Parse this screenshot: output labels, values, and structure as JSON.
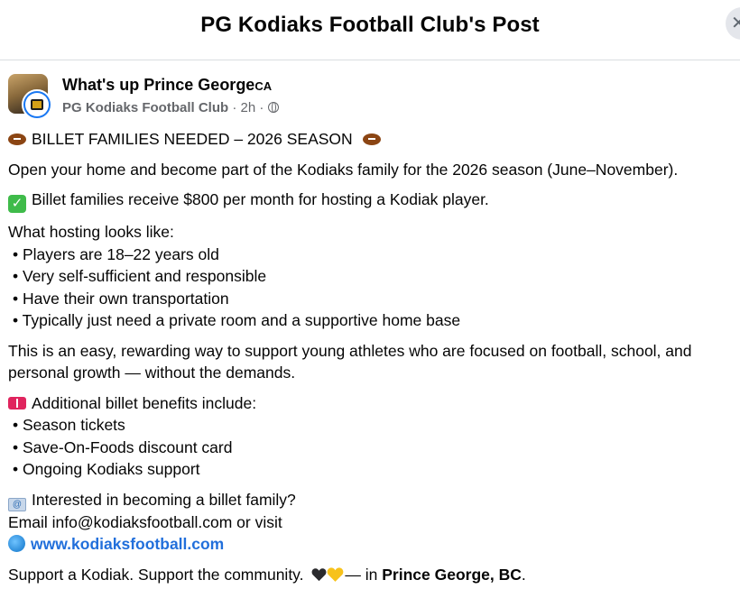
{
  "header": {
    "title": "PG Kodiaks Football Club's Post",
    "close_icon": "close-icon"
  },
  "author": {
    "group_name": "What's up Prince George",
    "group_suffix": "CA",
    "page_name": "PG Kodiaks Football Club",
    "separator": " · ",
    "time": "2h",
    "audience_icon": "globe-icon"
  },
  "post": {
    "headline": "BILLET FAMILIES NEEDED – 2026 SEASON",
    "intro": "Open your home and become part of the Kodiaks family for the 2026 season (June–November).",
    "payment": "Billet families receive $800 per month for hosting a Kodiak player.",
    "hosting_title": "What hosting looks like:",
    "hosting_items": [
      "• Players are 18–22 years old",
      "• Very self-sufficient and responsible",
      "• Have their own transportation",
      "• Typically just need a private room and a supportive home base"
    ],
    "rewarding_line1": "This is an easy, rewarding way to support young athletes who are focused on football, school, and",
    "rewarding_line2": "personal growth — without the demands.",
    "benefits_title": "Additional billet benefits include:",
    "benefit_items": [
      "• Season tickets",
      "• Save-On-Foods discount card",
      "• Ongoing Kodiaks support"
    ],
    "interested": "Interested in becoming a billet family?",
    "email_line": "Email info@kodiaksfootball.com or visit",
    "website": "www.kodiaksfootball.com",
    "closing": "Support a Kodiak. Support the community.",
    "closing_in": "— in ",
    "location": "Prince George, BC",
    "closing_end": "."
  },
  "colors": {
    "link": "#216fdb",
    "meta_text": "#65676b",
    "divider": "#dadde1"
  }
}
